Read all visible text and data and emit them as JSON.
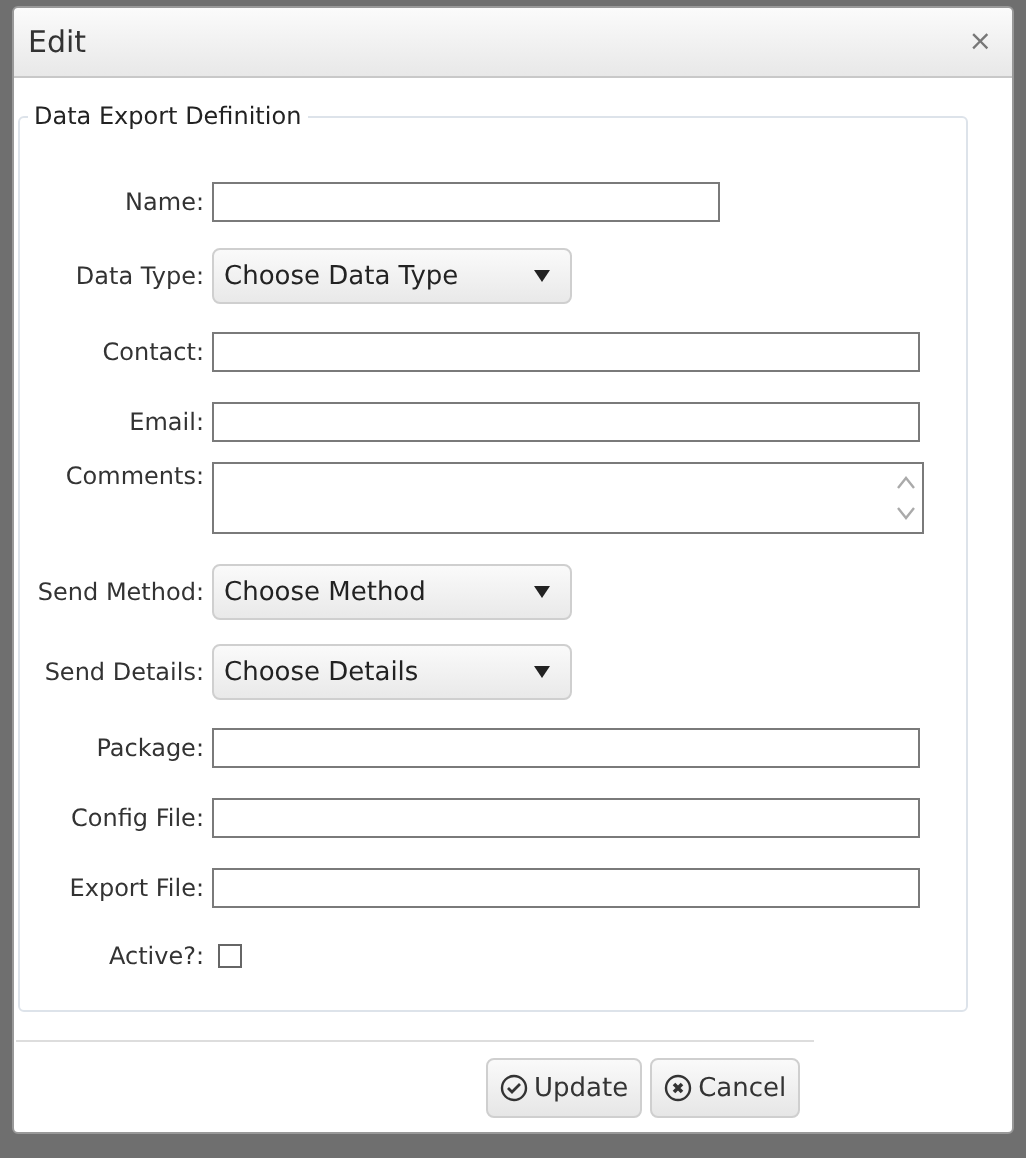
{
  "window": {
    "title": "Edit",
    "close": "×"
  },
  "form": {
    "legend": "Data Export Definition",
    "fields": [
      {
        "kind": "shorttext",
        "label": "Name:"
      },
      {
        "kind": "select",
        "label": "Data Type:",
        "value": "Choose Data Type"
      },
      {
        "kind": "text",
        "label": "Contact:"
      },
      {
        "kind": "text",
        "label": "Email:"
      },
      {
        "kind": "textarea",
        "label": "Comments:"
      },
      {
        "kind": "select",
        "label": "Send Method:",
        "value": "Choose Method"
      },
      {
        "kind": "select",
        "label": "Send Details:",
        "value": "Choose Details"
      },
      {
        "kind": "text",
        "label": "Package:"
      },
      {
        "kind": "text",
        "label": "Config File:"
      },
      {
        "kind": "text",
        "label": "Export File:"
      },
      {
        "kind": "checkbox",
        "label": "Active?:",
        "checked": false
      }
    ]
  },
  "buttons": [
    {
      "kind": "update",
      "label": "Update"
    },
    {
      "kind": "cancel",
      "label": "Cancel"
    }
  ]
}
